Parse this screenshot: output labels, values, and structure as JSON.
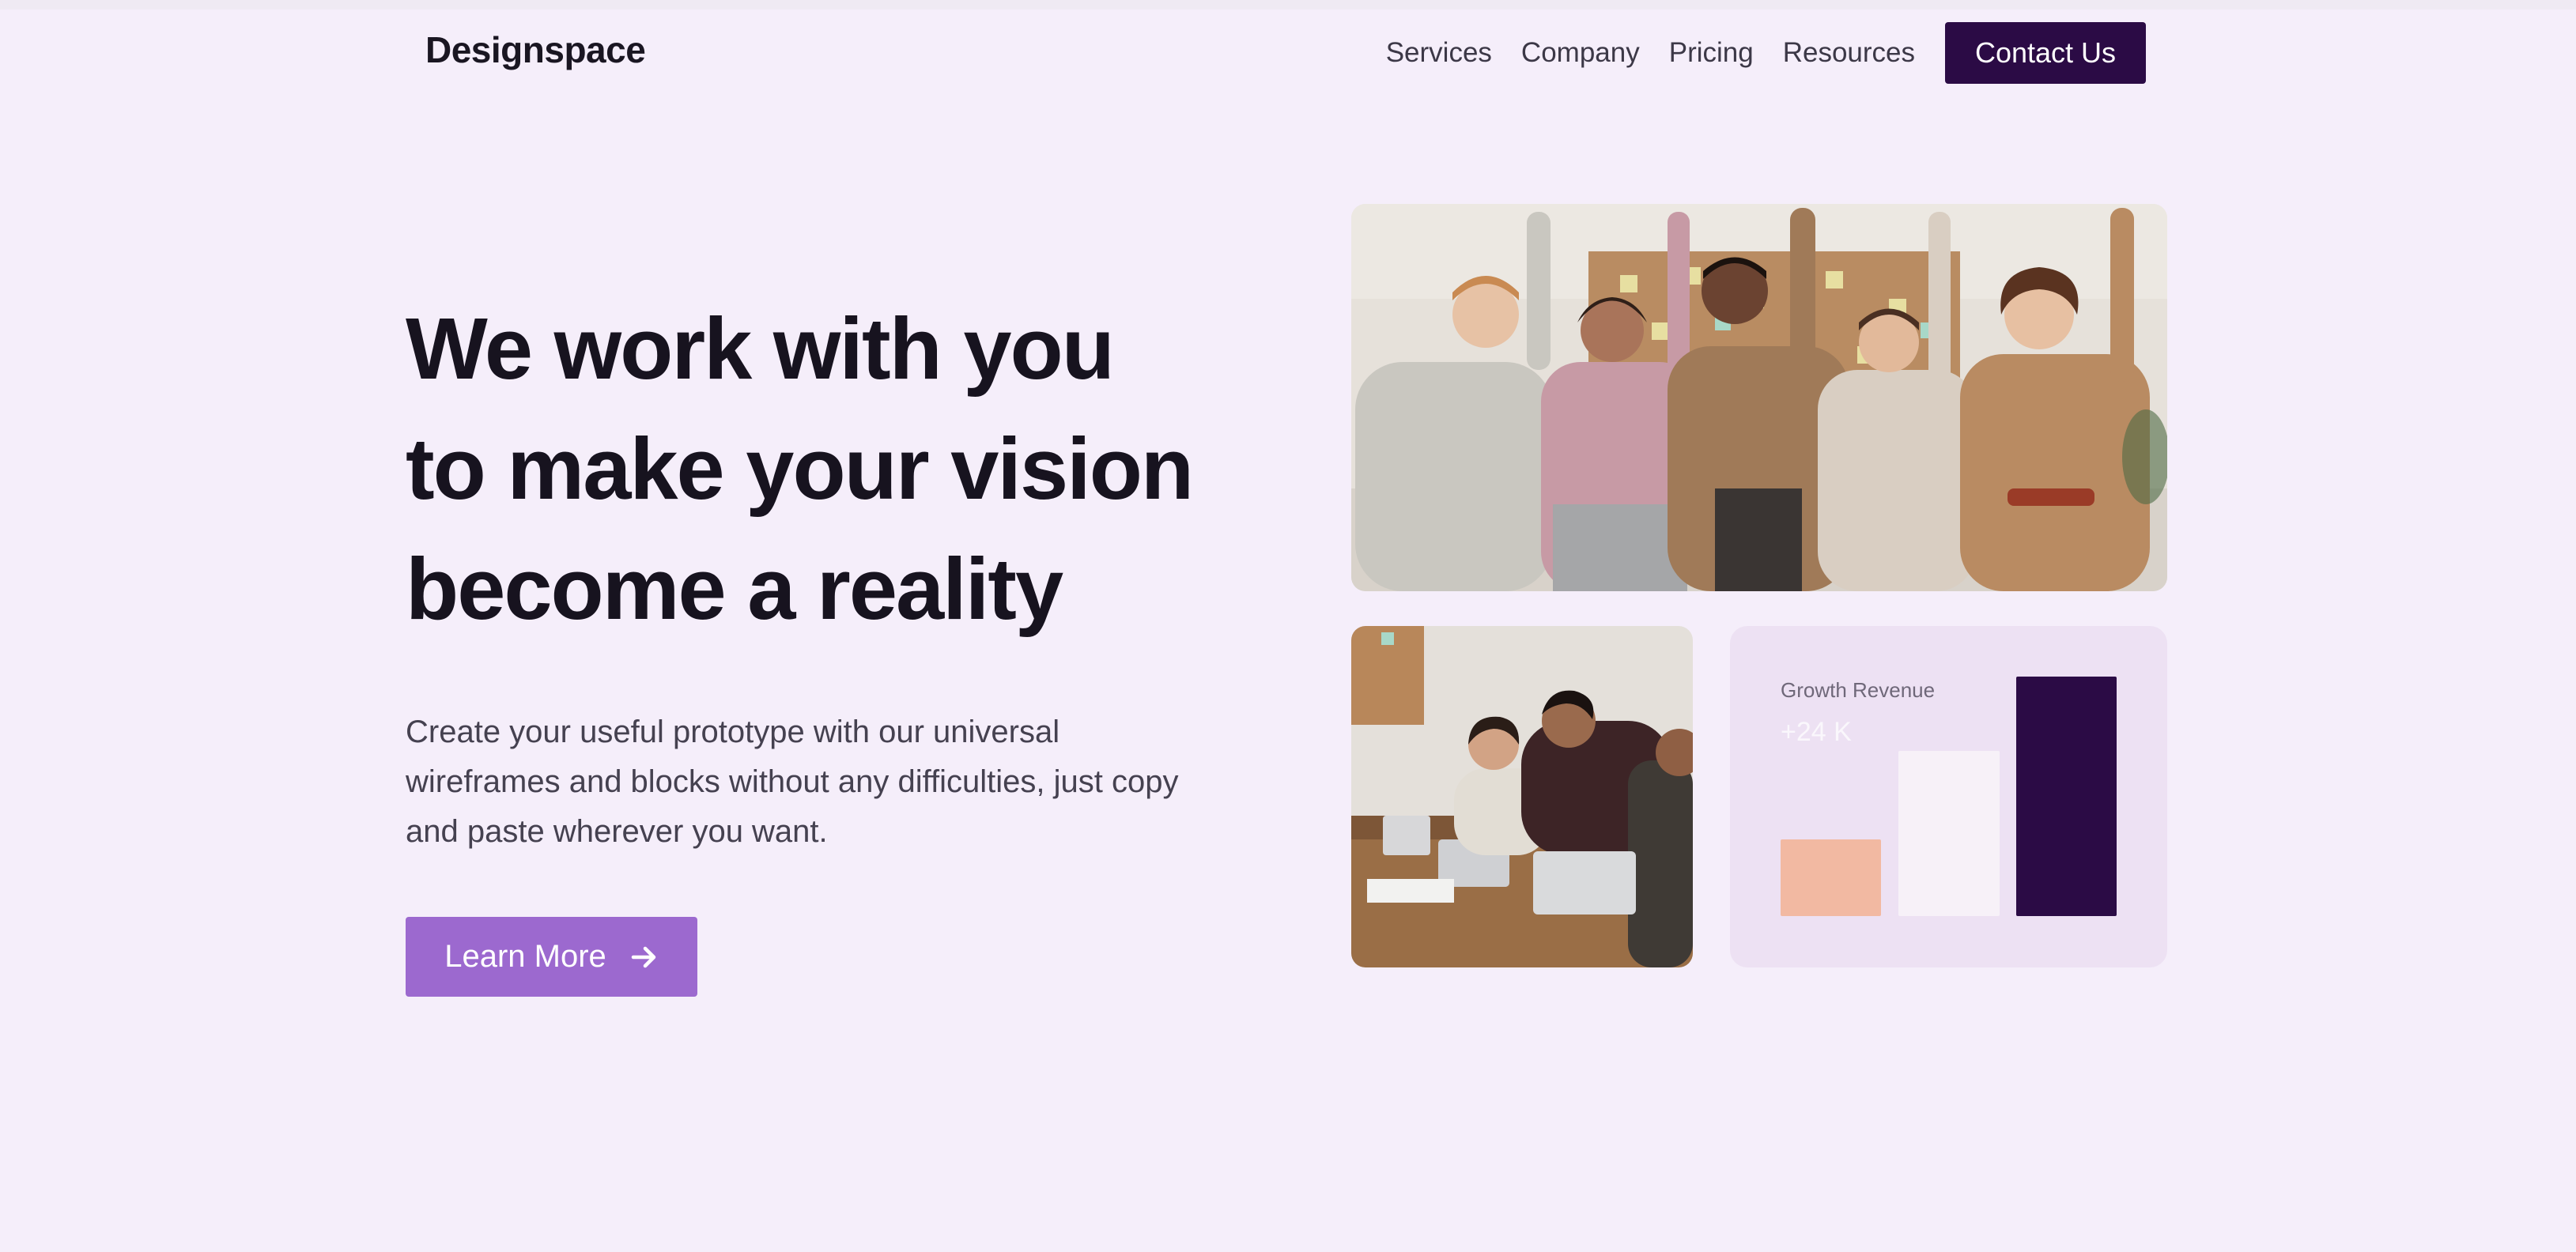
{
  "brand": {
    "name": "Designspace"
  },
  "nav": {
    "links": [
      "Services",
      "Company",
      "Pricing",
      "Resources"
    ],
    "cta_label": "Contact Us"
  },
  "hero": {
    "headline_lines": [
      "We work with you",
      "to make your vision",
      "become a reality"
    ],
    "subtext_lines": [
      "Create your useful prototype with our universal",
      "wireframes and blocks without any difficulties, just copy",
      "and paste wherever you want."
    ],
    "cta_label": "Learn More",
    "cta_icon": "arrow-right-icon"
  },
  "growth_card": {
    "title": "Growth Revenue",
    "value": "+24 K",
    "bars": [
      {
        "level": 0.32,
        "color": "#f2b9a2"
      },
      {
        "level": 0.69,
        "color": "#f7f1f8"
      },
      {
        "level": 1.0,
        "color": "#2b0b45"
      }
    ]
  },
  "colors": {
    "background": "#f5eefa",
    "primary_dark": "#2b0b45",
    "accent_purple": "#9c69cf",
    "card_bg": "#ede1f3"
  }
}
